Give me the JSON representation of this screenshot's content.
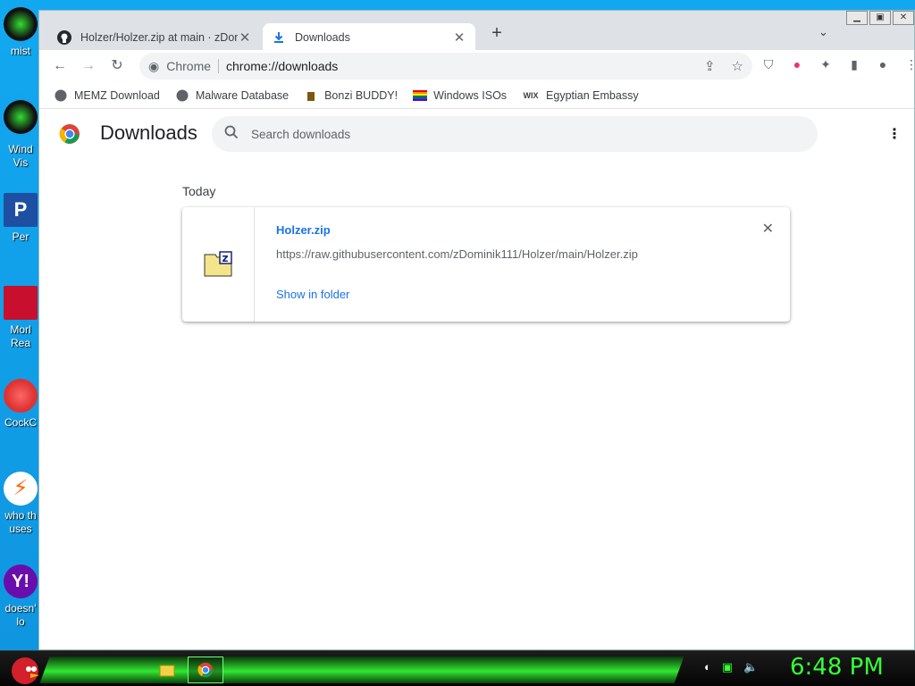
{
  "desktop": {
    "icons": [
      {
        "label": "mist"
      },
      {
        "label": "Wind"
      },
      {
        "label": "Vis"
      },
      {
        "label": "Per"
      },
      {
        "label": "Morl"
      },
      {
        "label": "Rea"
      },
      {
        "label": "CockC"
      },
      {
        "label": "who th"
      },
      {
        "label": "uses"
      },
      {
        "label": "doesn'"
      },
      {
        "label": "lo"
      }
    ]
  },
  "browser": {
    "tabs": [
      {
        "label": "Holzer/Holzer.zip at main · zDom",
        "icon": "github-icon"
      },
      {
        "label": "Downloads",
        "icon": "download-icon"
      }
    ],
    "omnibox": {
      "site": "Chrome",
      "url": "chrome://downloads"
    },
    "bookmarks": [
      {
        "label": "MEMZ Download",
        "icon": "globe-icon"
      },
      {
        "label": "Malware Database",
        "icon": "globe-icon"
      },
      {
        "label": "Bonzi BUDDY!",
        "icon": "bonzi-icon"
      },
      {
        "label": "Windows ISOs",
        "icon": "rainbow-flag-icon"
      },
      {
        "label": "Egyptian Embassy",
        "icon": "wix-icon"
      }
    ]
  },
  "downloads": {
    "title": "Downloads",
    "search_placeholder": "Search downloads",
    "section": "Today",
    "items": [
      {
        "filename": "Holzer.zip",
        "url": "https://raw.githubusercontent.com/zDominik111/Holzer/main/Holzer.zip",
        "action": "Show in folder"
      }
    ]
  },
  "taskbar": {
    "clock": "6:48 PM"
  },
  "colors": {
    "accent": "#1a73e8",
    "clock": "#36ff36"
  }
}
